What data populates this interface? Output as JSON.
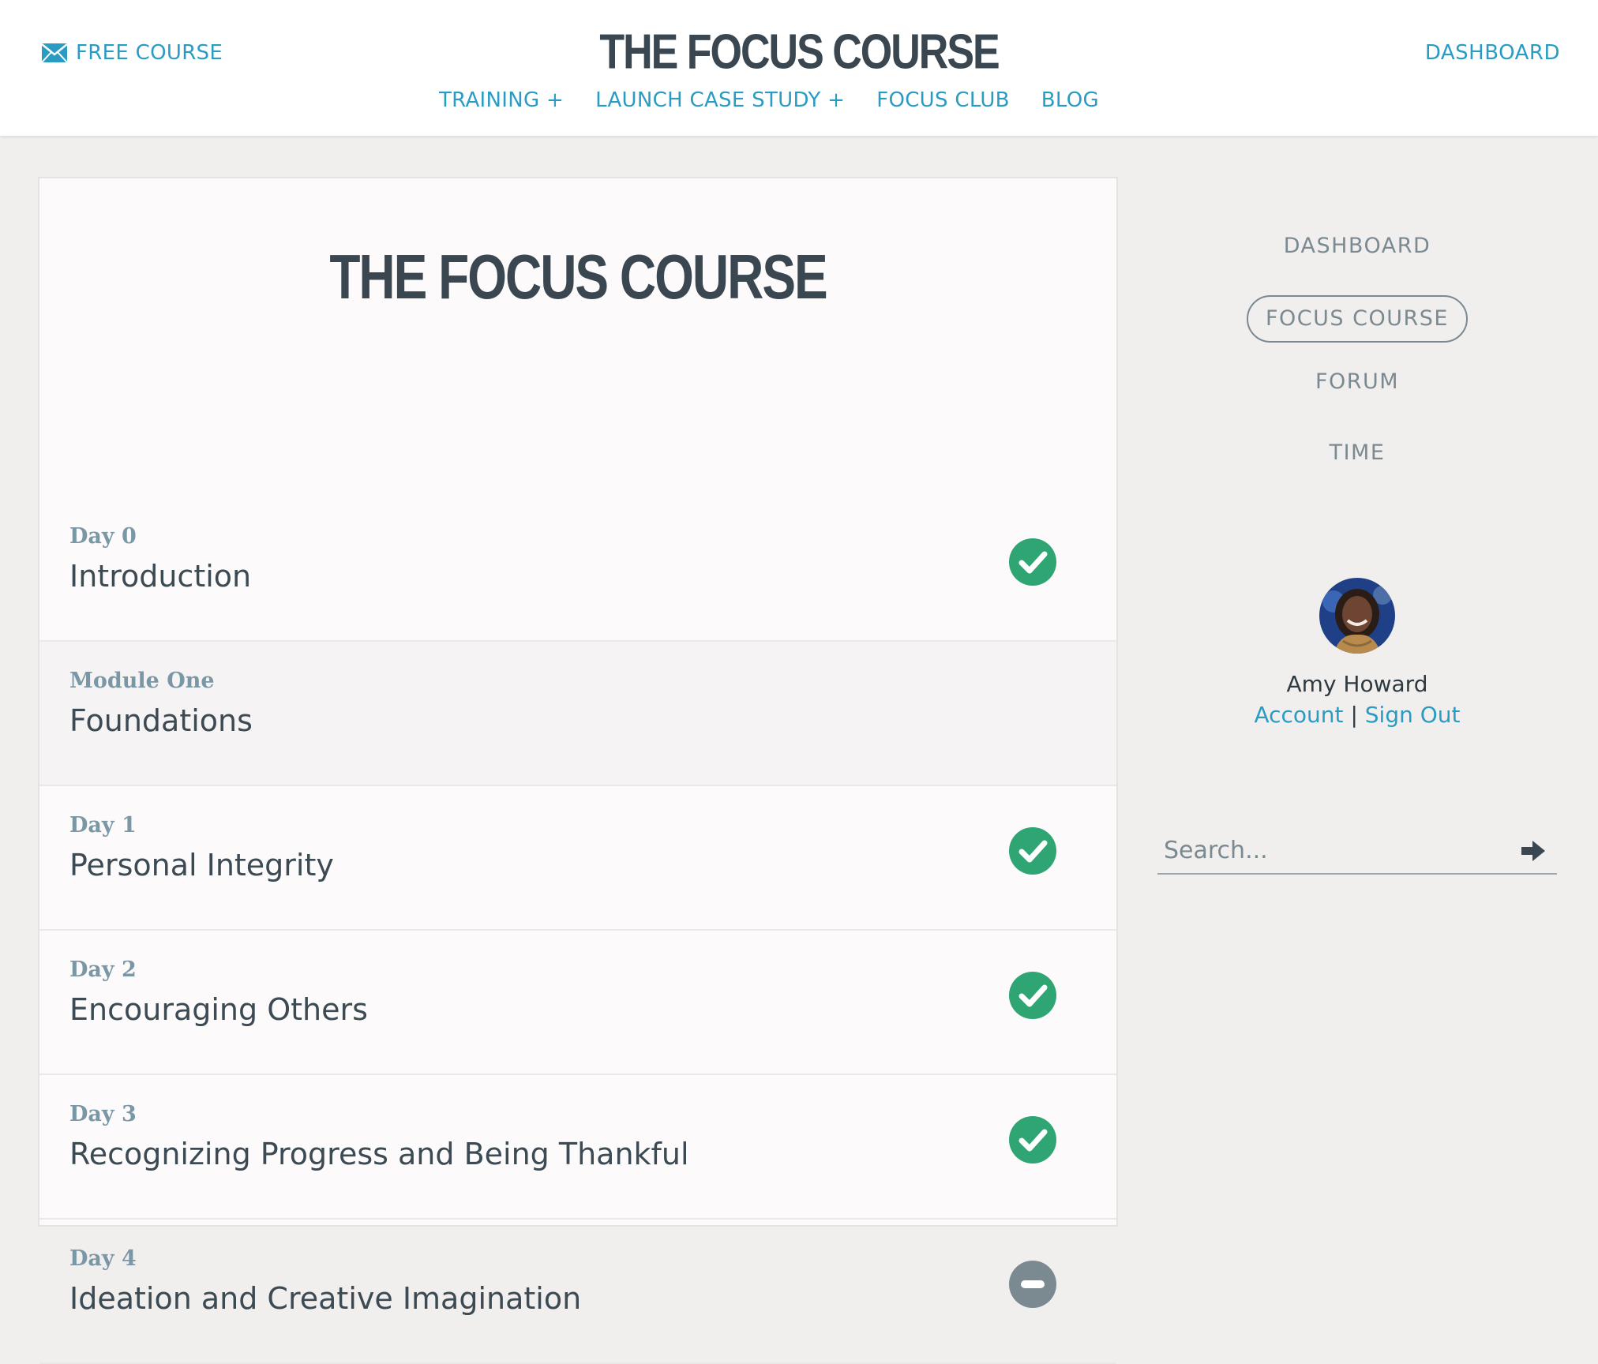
{
  "header": {
    "free_course_label": "FREE COURSE",
    "brand": "THE FOCUS COURSE",
    "dashboard_label": "DASHBOARD",
    "nav": [
      {
        "label": "TRAINING +"
      },
      {
        "label": "LAUNCH CASE STUDY +"
      },
      {
        "label": "FOCUS CLUB"
      },
      {
        "label": "BLOG"
      }
    ]
  },
  "course": {
    "title": "THE FOCUS COURSE",
    "lessons": [
      {
        "kicker": "Day 0",
        "title": "Introduction",
        "status": "complete"
      },
      {
        "kicker": "Module One",
        "title": "Foundations",
        "status": "none"
      },
      {
        "kicker": "Day 1",
        "title": "Personal Integrity",
        "status": "complete"
      },
      {
        "kicker": "Day 2",
        "title": "Encouraging Others",
        "status": "complete"
      },
      {
        "kicker": "Day 3",
        "title": "Recognizing Progress and Being Thankful",
        "status": "complete"
      },
      {
        "kicker": "Day 4",
        "title": "Ideation and Creative Imagination",
        "status": "incomplete"
      }
    ]
  },
  "sidebar": {
    "nav": [
      {
        "label": "DASHBOARD",
        "active": false
      },
      {
        "label": "FOCUS COURSE",
        "active": true
      },
      {
        "label": "FORUM",
        "active": false
      },
      {
        "label": "TIME",
        "active": false
      }
    ],
    "user": {
      "name": "Amy Howard",
      "account_label": "Account",
      "separator": "|",
      "signout_label": "Sign Out"
    },
    "search": {
      "placeholder": "Search..."
    }
  },
  "colors": {
    "link": "#2a9cc4",
    "complete": "#2fa574",
    "incomplete": "#7b8a91",
    "title": "#3a4750"
  },
  "icons": {
    "free_course": "envelope-icon",
    "complete": "check-circle-icon",
    "incomplete": "minus-circle-icon",
    "search_submit": "arrow-right-icon"
  }
}
